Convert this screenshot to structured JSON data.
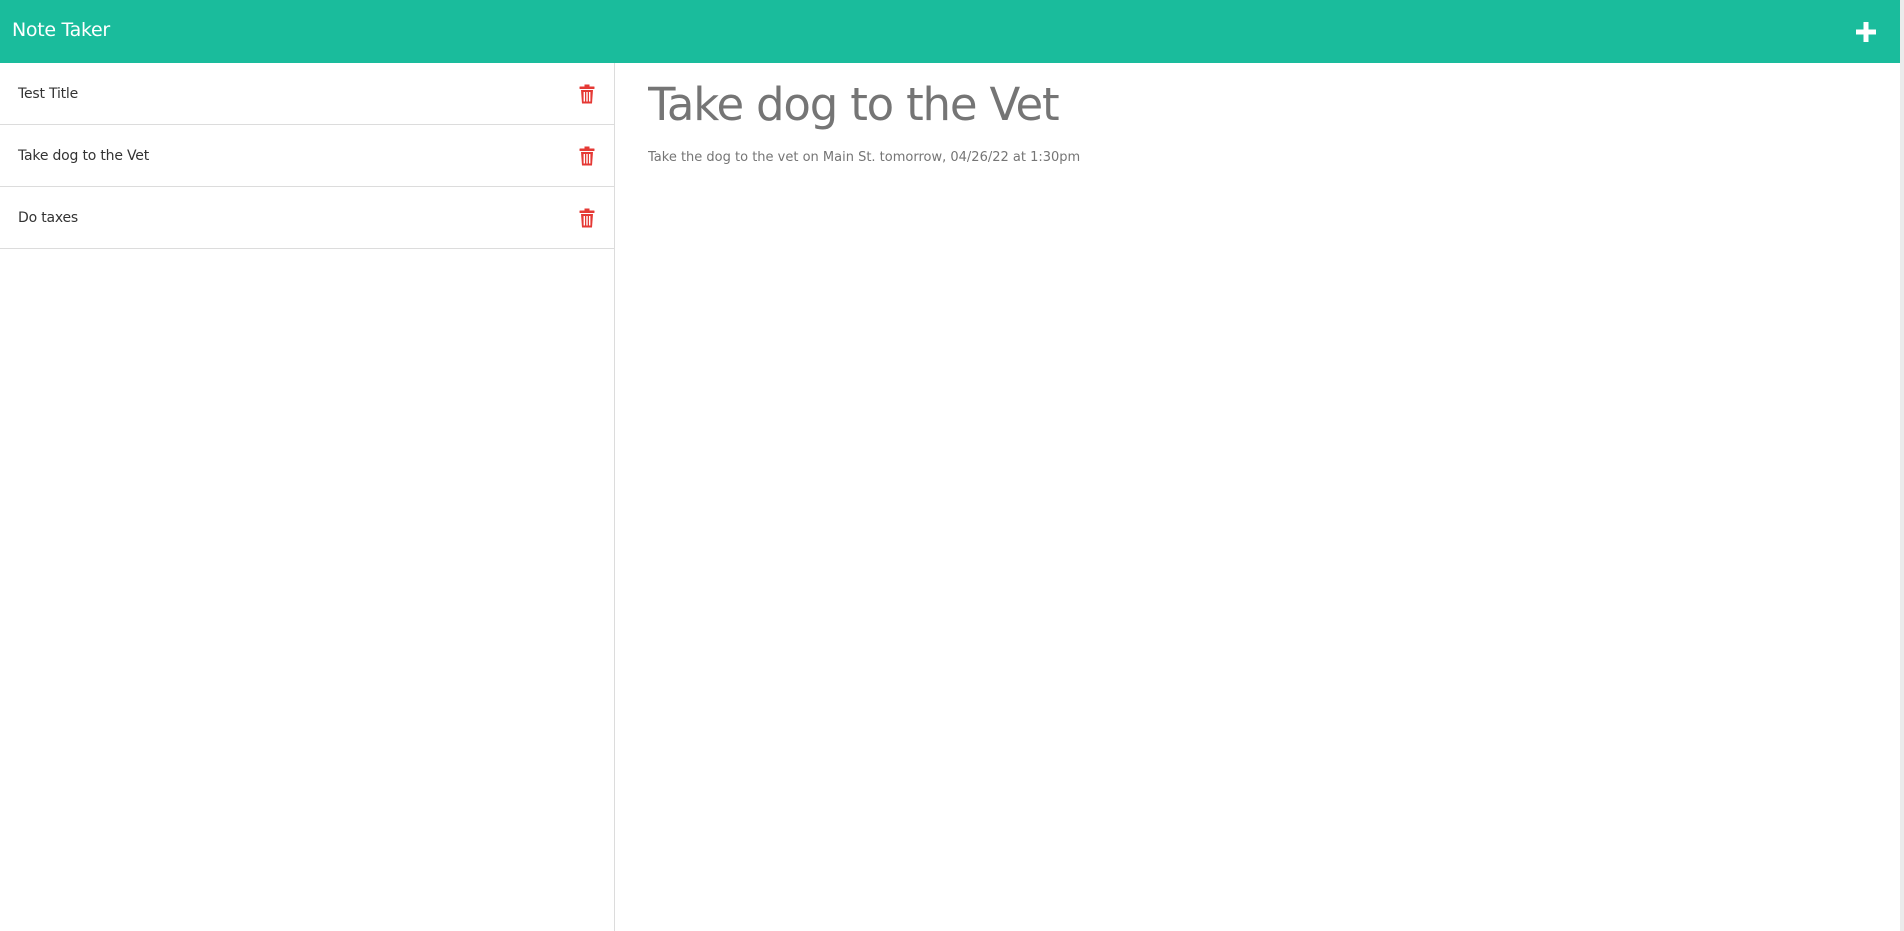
{
  "app": {
    "title": "Note Taker"
  },
  "navbar": {
    "new_note_icon": "plus-icon",
    "color": "#1abc9c"
  },
  "notes": [
    {
      "title": "Test Title",
      "delete_icon": "trash-icon"
    },
    {
      "title": "Take dog to the Vet",
      "delete_icon": "trash-icon"
    },
    {
      "title": "Do taxes",
      "delete_icon": "trash-icon"
    }
  ],
  "active_note": {
    "title": "Take dog to the Vet",
    "text": "Take the dog to the vet on Main St. tomorrow, 04/26/22 at 1:30pm"
  },
  "colors": {
    "accent": "#1abc9c",
    "delete": "#e53935",
    "note_text": "#757575"
  }
}
